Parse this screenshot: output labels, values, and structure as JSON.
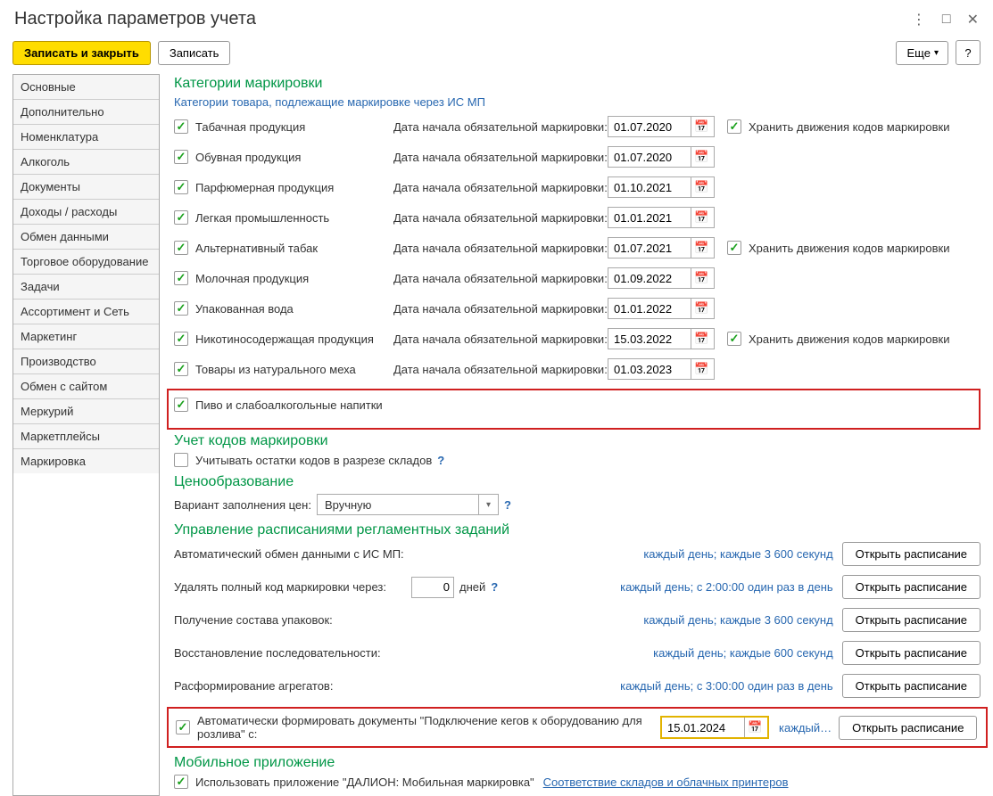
{
  "window": {
    "title": "Настройка параметров учета"
  },
  "toolbar": {
    "save_close": "Записать и закрыть",
    "save": "Записать",
    "more": "Еще",
    "help": "?"
  },
  "sidebar": {
    "items": [
      "Основные",
      "Дополнительно",
      "Номенклатура",
      "Алкоголь",
      "Документы",
      "Доходы / расходы",
      "Обмен данными",
      "Торговое оборудование",
      "Задачи",
      "Ассортимент и Сеть",
      "Маркетинг",
      "Производство",
      "Обмен с сайтом",
      "Меркурий",
      "Маркетплейсы",
      "Маркировка"
    ]
  },
  "categories": {
    "title": "Категории маркировки",
    "subtitle": "Категории товара, подлежащие маркировке через ИС МП",
    "date_label": "Дата начала обязательной маркировки:",
    "store_label": "Хранить движения кодов маркировки",
    "items": [
      {
        "name": "Табачная продукция",
        "date": "01.07.2020",
        "store": true
      },
      {
        "name": "Обувная продукция",
        "date": "01.07.2020",
        "store": false
      },
      {
        "name": "Парфюмерная продукция",
        "date": "01.10.2021",
        "store": false
      },
      {
        "name": "Легкая промышленность",
        "date": "01.01.2021",
        "store": false
      },
      {
        "name": "Альтернативный табак",
        "date": "01.07.2021",
        "store": true
      },
      {
        "name": "Молочная продукция",
        "date": "01.09.2022",
        "store": false
      },
      {
        "name": "Упакованная вода",
        "date": "01.01.2022",
        "store": false
      },
      {
        "name": "Никотиносодержащая продукция",
        "date": "15.03.2022",
        "store": true
      },
      {
        "name": "Товары из натурального меха",
        "date": "01.03.2023",
        "store": false
      }
    ],
    "beer": "Пиво и слабоалкогольные напитки"
  },
  "codes": {
    "title": "Учет кодов маркировки",
    "by_warehouse": "Учитывать остатки кодов в разрезе складов"
  },
  "pricing": {
    "title": "Ценообразование",
    "label": "Вариант заполнения цен:",
    "value": "Вручную"
  },
  "schedules": {
    "title": "Управление расписаниями регламентных заданий",
    "open_btn": "Открыть расписание",
    "rows": [
      {
        "label": "Автоматический обмен данными с ИС МП:",
        "schedule": "каждый день; каждые 3 600 секунд"
      },
      {
        "label": "Удалять полный код маркировки через:",
        "days_value": "0",
        "days_word": "дней",
        "schedule": "каждый день; с 2:00:00 один раз в день"
      },
      {
        "label": "Получение состава упаковок:",
        "schedule": "каждый день; каждые 3 600 секунд"
      },
      {
        "label": "Восстановление последовательности:",
        "schedule": "каждый день; каждые 600 секунд"
      },
      {
        "label": "Расформирование агрегатов:",
        "schedule": "каждый день; с 3:00:00 один раз в день"
      }
    ],
    "auto_keg": {
      "text": "Автоматически формировать документы \"Подключение кегов к оборудованию для розлива\" с:",
      "date": "15.01.2024",
      "schedule": "каждый…"
    }
  },
  "mobile": {
    "title": "Мобильное приложение",
    "checkbox": "Использовать приложение \"ДАЛИОН: Мобильная маркировка\"",
    "link": "Соответствие складов и облачных принтеров"
  }
}
